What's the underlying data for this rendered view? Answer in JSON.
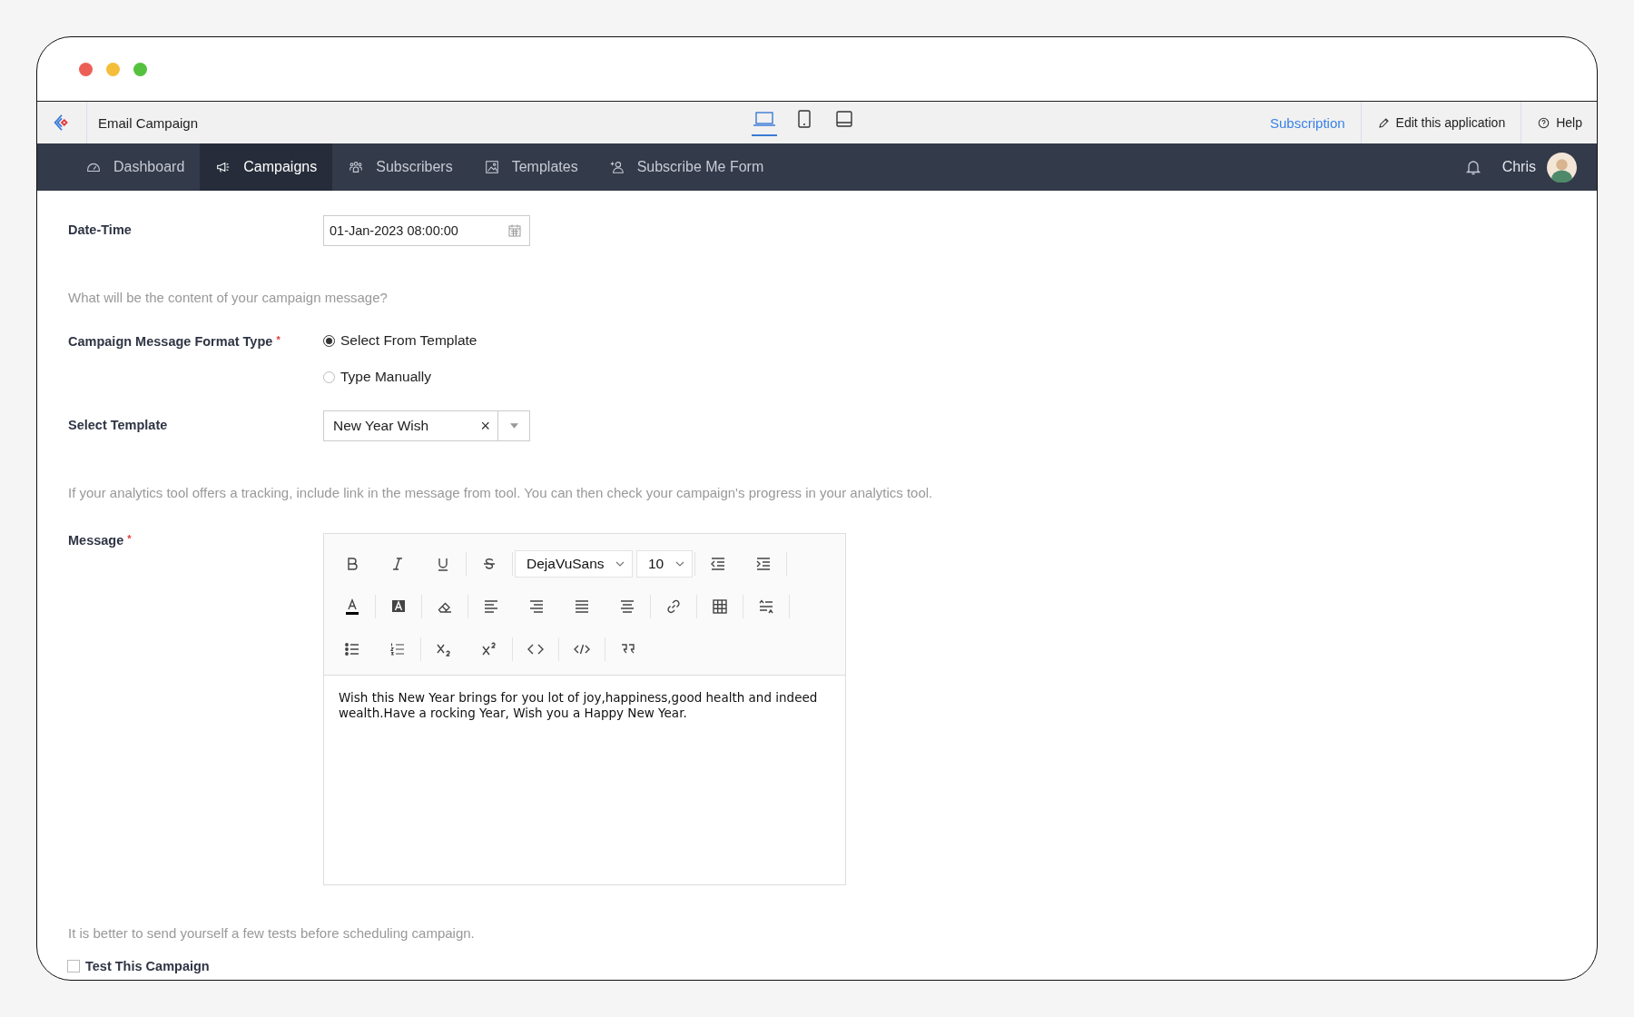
{
  "app_bar": {
    "title": "Email Campaign",
    "devices": [
      {
        "kind": "laptop",
        "selected": true
      },
      {
        "kind": "phone",
        "selected": false
      },
      {
        "kind": "tablet",
        "selected": false
      }
    ],
    "subscription_link": "Subscription",
    "edit_button": "Edit this application",
    "help_button": "Help"
  },
  "nav": {
    "items": [
      {
        "kind": "dashboard",
        "label": "Dashboard",
        "selected": false
      },
      {
        "kind": "campaigns",
        "label": "Campaigns",
        "selected": true
      },
      {
        "kind": "subscribers",
        "label": "Subscribers",
        "selected": false
      },
      {
        "kind": "templates",
        "label": "Templates",
        "selected": false
      },
      {
        "kind": "form",
        "label": "Subscribe Me Form",
        "selected": false
      }
    ],
    "user": "Chris"
  },
  "form": {
    "date_time": {
      "label": "Date-Time",
      "value": "01-Jan-2023 08:00:00"
    },
    "content_hint": "What will be the content of your campaign message?",
    "format_type": {
      "label": "Campaign Message Format Type",
      "required_mark": "*",
      "options": [
        {
          "label": "Select From Template",
          "selected": true
        },
        {
          "label": "Type Manually",
          "selected": false
        }
      ]
    },
    "template": {
      "label": "Select Template",
      "value": "New Year Wish",
      "clear": "×"
    },
    "analytics_hint": "If your analytics tool offers a tracking, include link in the message from tool. You can then check your campaign's progress in your analytics tool.",
    "message": {
      "label": "Message",
      "required_mark": "*",
      "font": "DejaVuSans",
      "size": "10",
      "body": "Wish this New Year brings for you lot of joy,happiness,good health and indeed wealth.Have a rocking Year, Wish you a Happy New Year."
    },
    "test_hint": "It is better to send yourself a few tests before scheduling campaign.",
    "test_checkbox": {
      "label": "Test This Campaign",
      "checked": false
    }
  }
}
